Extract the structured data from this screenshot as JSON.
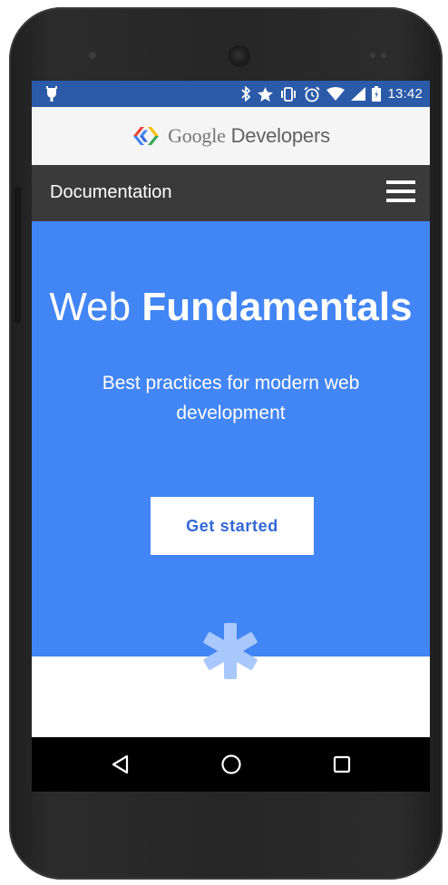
{
  "status_bar": {
    "time": "13:42",
    "background": "#2b5aa8",
    "icons": [
      "debug-icon",
      "bluetooth-icon",
      "star-icon",
      "vibrate-icon",
      "alarm-icon",
      "wifi-icon",
      "signal-icon",
      "battery-icon"
    ]
  },
  "header": {
    "logo_brand": "Google",
    "logo_product": "Developers",
    "logo_colors": [
      "#4285f4",
      "#ea4335",
      "#fbbc05",
      "#34a853"
    ]
  },
  "doc_bar": {
    "label": "Documentation",
    "background": "#3a3a3a"
  },
  "hero": {
    "title_light": "Web",
    "title_bold": "Fundamentals",
    "subtitle": "Best practices for modern web development",
    "cta_label": "Get started",
    "background": "#4285f4",
    "accent_asterisk_color": "#a9c8fb"
  },
  "nav_bar": {
    "buttons": [
      "back-icon",
      "home-icon",
      "recents-icon"
    ]
  }
}
